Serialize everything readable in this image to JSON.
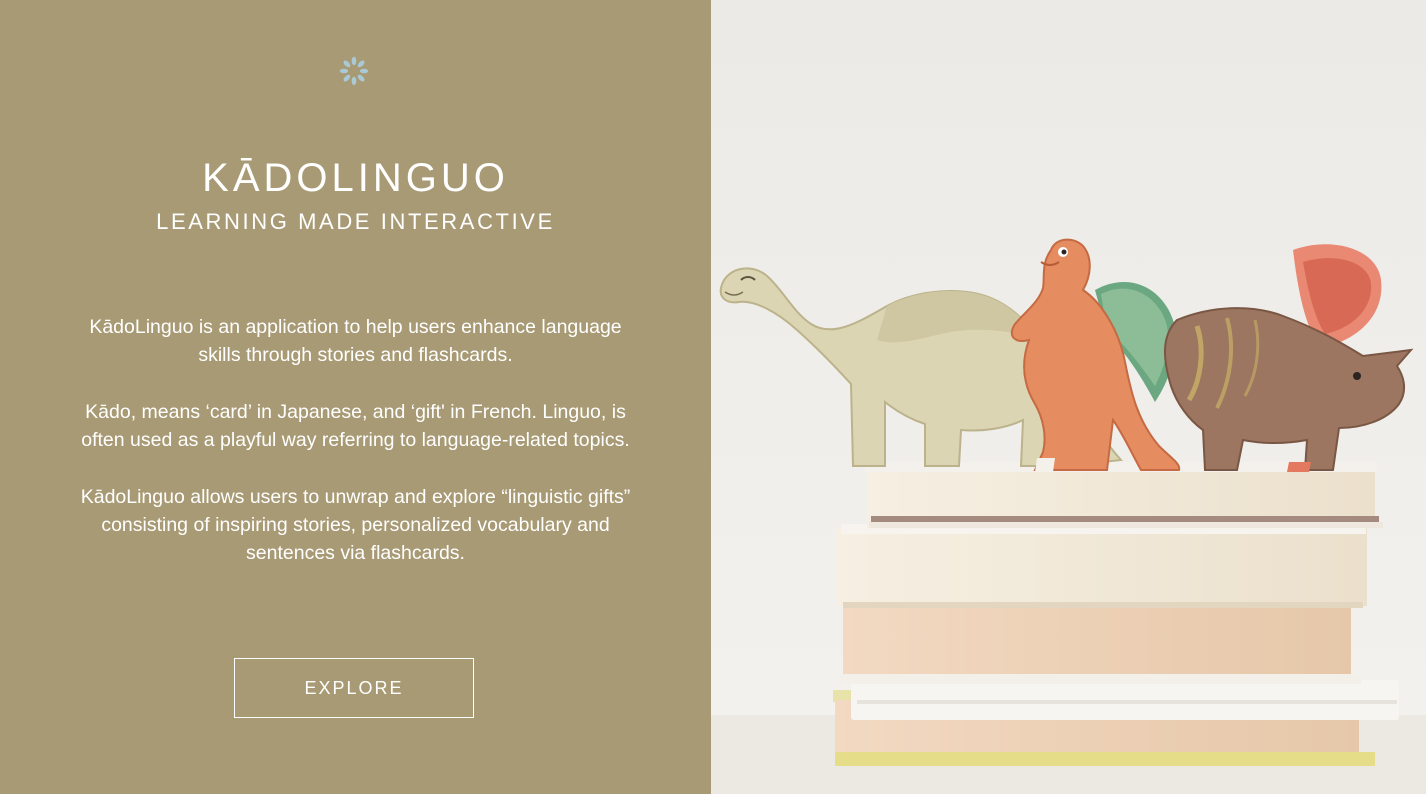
{
  "brand": {
    "title": "KĀDOLINGUO",
    "subtitle": "LEARNING MADE INTERACTIVE",
    "logo_icon": "flower-asterisk-icon",
    "logo_color": "#a9c9d6"
  },
  "description": {
    "paragraphs": [
      "KādoLinguo is an application to help users enhance language skills through stories and flashcards.",
      "Kādo, means ‘card’ in Japanese, and ‘gift' in French. Linguo, is often used as a playful way referring to language-related topics.",
      "KādoLinguo allows users to unwrap and explore “linguistic gifts” consisting of inspiring stories, personalized vocabulary and sentences via flashcards."
    ]
  },
  "cta": {
    "label": "EXPLORE"
  },
  "hero_image": {
    "subject": "wooden toy dinosaurs on a stack of books"
  },
  "colors": {
    "panel_background": "#a89a74",
    "text": "#ffffff"
  }
}
